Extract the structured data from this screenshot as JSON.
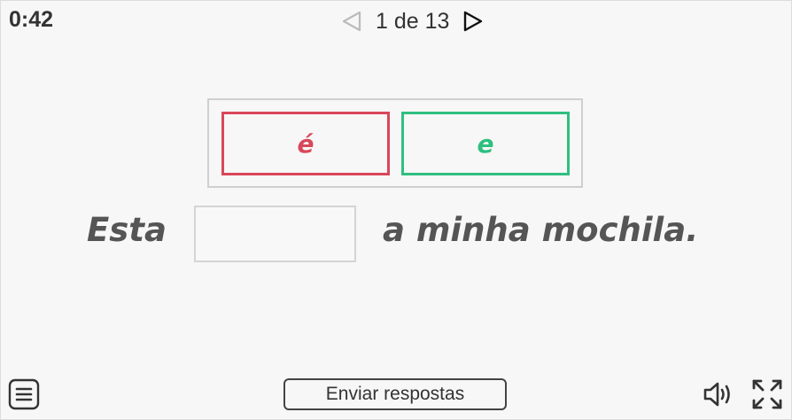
{
  "header": {
    "timer": "0:42",
    "page_label": "1 de 13",
    "prev_icon": "triangle-left-outline",
    "next_icon": "triangle-right-outline"
  },
  "options": [
    {
      "text": "é",
      "color": "#d9475a"
    },
    {
      "text": "e",
      "color": "#2fbf7f"
    }
  ],
  "sentence": {
    "before": "Esta",
    "after": "a minha mochila."
  },
  "footer": {
    "menu_icon": "hamburger-menu",
    "submit_label": "Enviar respostas",
    "sound_icon": "speaker",
    "fullscreen_icon": "expand-arrows"
  }
}
